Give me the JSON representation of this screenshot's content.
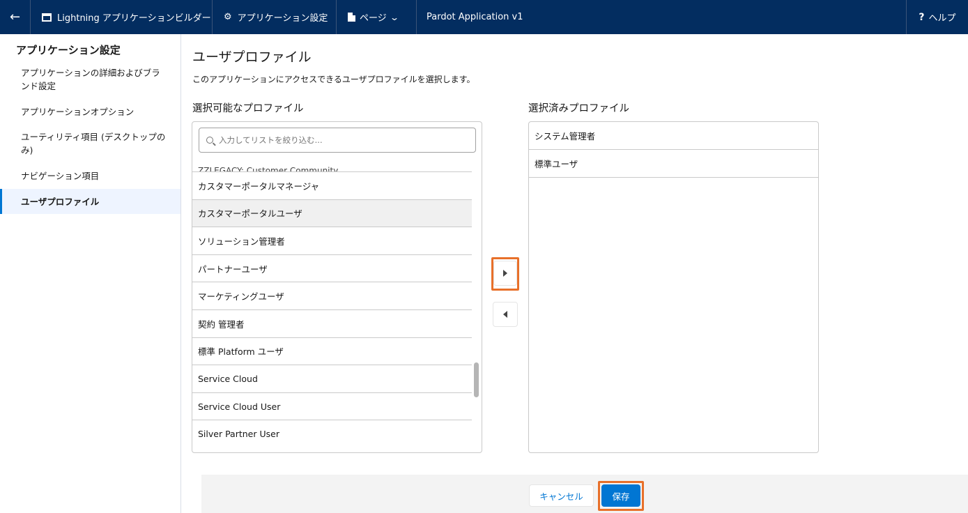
{
  "topbar": {
    "back_icon": "←",
    "builder_label": "Lightning アプリケーションビルダー",
    "settings_icon": "⚙",
    "settings_label": "アプリケーション設定",
    "pages_label": "ページ",
    "chevron": "⌄",
    "app_name": "Pardot Application v1",
    "help_icon": "?",
    "help_label": "ヘルプ"
  },
  "sidebar": {
    "title": "アプリケーション設定",
    "items": [
      {
        "label": "アプリケーションの詳細およびブランド設定"
      },
      {
        "label": "アプリケーションオプション"
      },
      {
        "label": "ユーティリティ項目 (デスクトップのみ)"
      },
      {
        "label": "ナビゲーション項目"
      },
      {
        "label": "ユーザプロファイル"
      }
    ]
  },
  "main": {
    "title": "ユーザプロファイル",
    "description": "このアプリケーションにアクセスできるユーザプロファイルを選択します。",
    "available_label": "選択可能なプロファイル",
    "selected_label": "選択済みプロファイル",
    "search_placeholder": "入力してリストを絞り込む...",
    "available": [
      "ZZLEGACY: Customer Community",
      "カスタマーポータルマネージャ",
      "カスタマーポータルユーザ",
      "ソリューション管理者",
      "パートナーユーザ",
      "マーケティングユーザ",
      "契約 管理者",
      "標準 Platform ユーザ",
      "Service Cloud",
      "Service Cloud User",
      "Silver Partner User"
    ],
    "selected": [
      "システム管理者",
      "標準ユーザ"
    ]
  },
  "footer": {
    "cancel_label": "キャンセル",
    "save_label": "保存"
  },
  "colors": {
    "header_bg": "#032d60",
    "brand_blue": "#0176d3",
    "highlight_orange": "#e8702a"
  }
}
